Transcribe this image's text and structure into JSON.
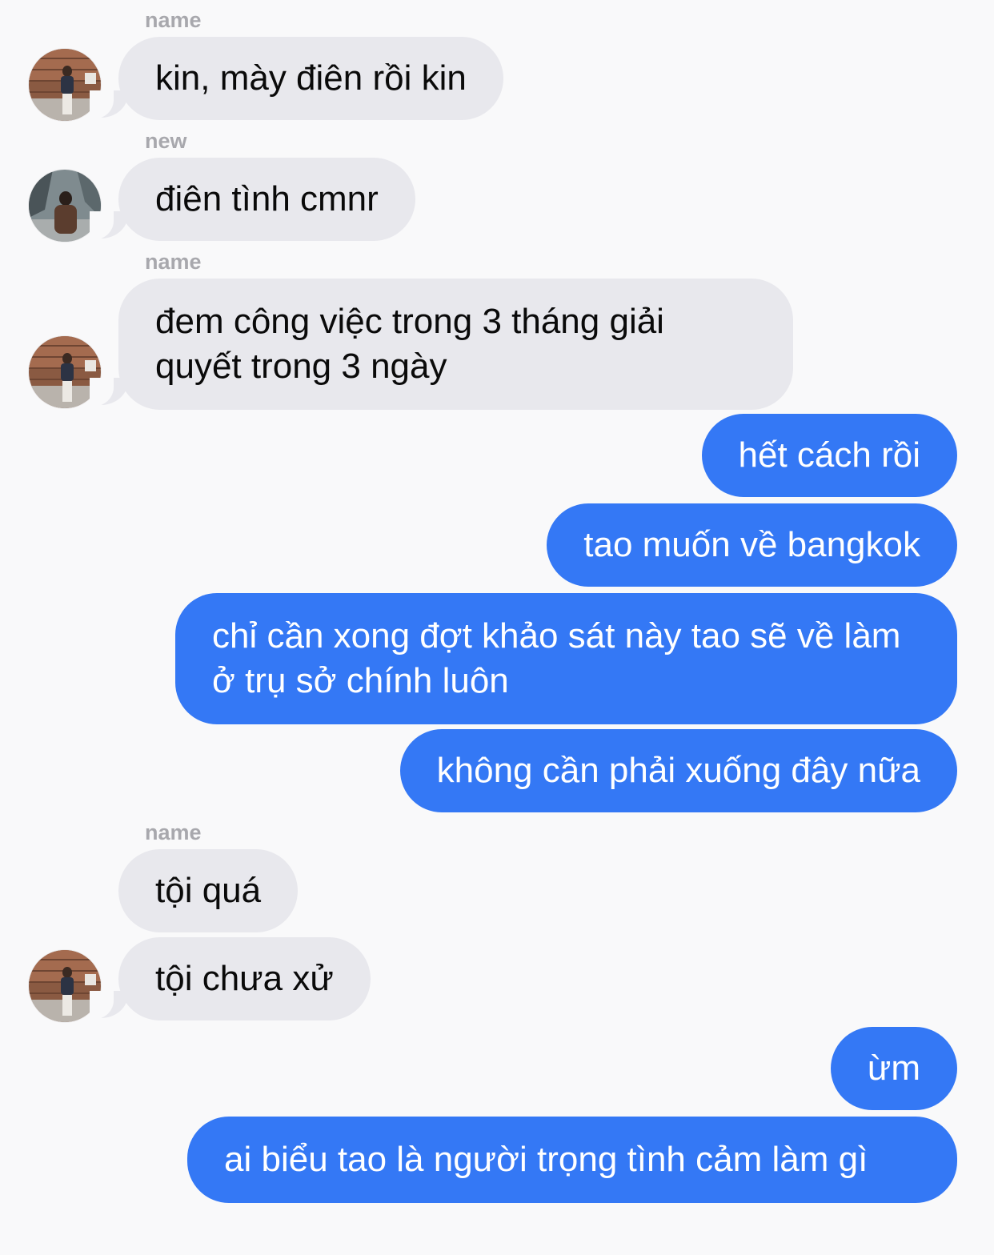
{
  "messages": [
    {
      "sender": "name",
      "text": "kin, mày điên rồi kin"
    },
    {
      "sender": "new",
      "text": "điên tình cmnr"
    },
    {
      "sender": "name",
      "text": "đem công việc trong 3 tháng giải quyết trong 3 ngày"
    },
    {
      "text": "hết cách rồi"
    },
    {
      "text": "tao muốn về bangkok"
    },
    {
      "text": "chỉ cần xong đợt khảo sát này tao sẽ về làm ở trụ sở chính luôn"
    },
    {
      "text": "không cần phải xuống đây nữa"
    },
    {
      "sender": "name",
      "text": "tội quá"
    },
    {
      "text": "tội chưa xử"
    },
    {
      "text": "ừm"
    },
    {
      "text": "ai biểu tao là người trọng tình cảm làm gì"
    }
  ],
  "colors": {
    "incoming_bubble": "#e8e8ed",
    "outgoing_bubble": "#3478f5",
    "sender_name": "#a8a8ad",
    "background": "#f9f9fa"
  }
}
